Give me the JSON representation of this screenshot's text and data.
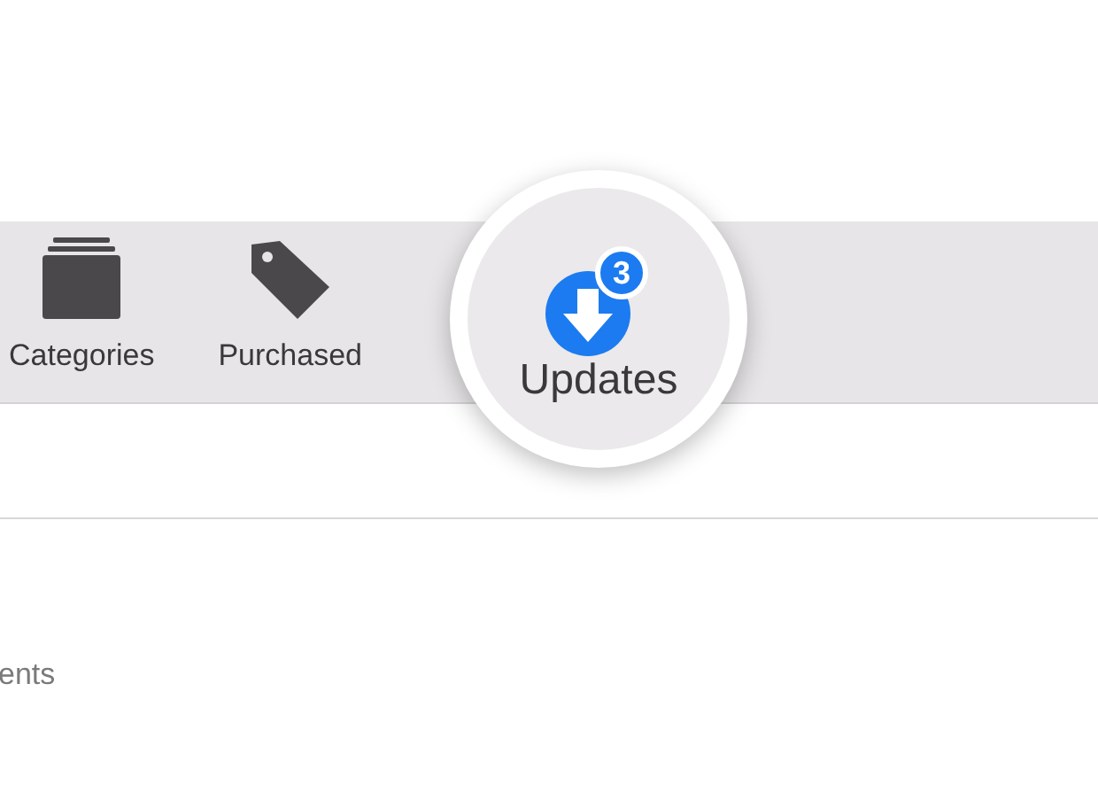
{
  "toolbar": {
    "items": [
      {
        "kind": "categories",
        "label": "Categories"
      },
      {
        "kind": "purchased",
        "label": "Purchased"
      }
    ]
  },
  "magnified_item": {
    "label": "Updates",
    "badge": "3"
  },
  "content": {
    "text": "ents"
  }
}
